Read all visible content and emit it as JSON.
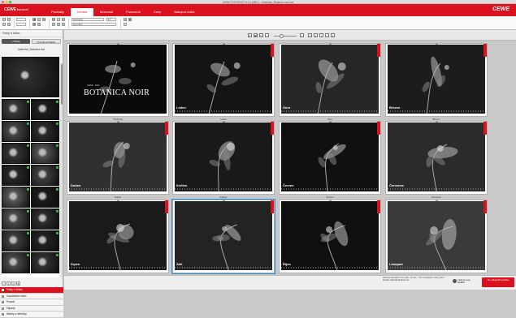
{
  "window": {
    "title": "CEWE FOTOSVET 6.4.5 (ABC) – Kalendar_Botanica noir.mcf"
  },
  "app": {
    "logo": "CEWE",
    "logo_sub": "fotosvet",
    "brand": "CEWE"
  },
  "menu": {
    "tabs": [
      "Produkty",
      "Vzhled",
      "Možnosti",
      "Pomocník",
      "Ceny",
      "Nákupní košík"
    ],
    "active_index": 1
  },
  "toolbar": {
    "font_name": "Helvetica",
    "font_size": "11",
    "style_name": "Normální"
  },
  "sidebar": {
    "header": "Fotky a videa",
    "btn_add": "+ Přidat",
    "btn_new_folder": "Vytvořit schránku",
    "folder_title": "Kalendar_Botanica noir",
    "check": "✓",
    "nav": [
      "Fotky a Videa",
      "Uspořádání strán",
      "Pozadí",
      "Klipartý",
      "Masky a rámečky"
    ],
    "nav_active": 0
  },
  "pages": [
    {
      "label": "",
      "caption": "Titulní list"
    },
    {
      "label": "Leden",
      "caption": "Leden"
    },
    {
      "label": "Únor",
      "caption": "Únor"
    },
    {
      "label": "Březen",
      "caption": "Březen"
    },
    {
      "label": "Duben",
      "caption": "Duben"
    },
    {
      "label": "Květen",
      "caption": "Květen"
    },
    {
      "label": "Červen",
      "caption": "Červen"
    },
    {
      "label": "Červenec",
      "caption": "Červenec"
    },
    {
      "label": "Srpen",
      "caption": "Srpen"
    },
    {
      "label": "Září",
      "caption": "Září"
    },
    {
      "label": "Říjen",
      "caption": "Říjen"
    },
    {
      "label": "Listopad",
      "caption": "Listopad"
    }
  ],
  "cover": {
    "small": "CEWE · 2024",
    "title": "BOTANICA NOIR"
  },
  "bottom": {
    "info": "Nástěnný kalendář A4 na výšku, 14 stran – Tisk na fotopapír, lesklý povrch. Produkt: Kalendář Botanica noir.",
    "price_label": "Celková cena",
    "price_value": "44,48 €",
    "cart_label": "Do nákupního košíku"
  },
  "colors": {
    "accent": "#d9121e",
    "selection": "#2a8fd8",
    "check": "#2ba23a"
  }
}
